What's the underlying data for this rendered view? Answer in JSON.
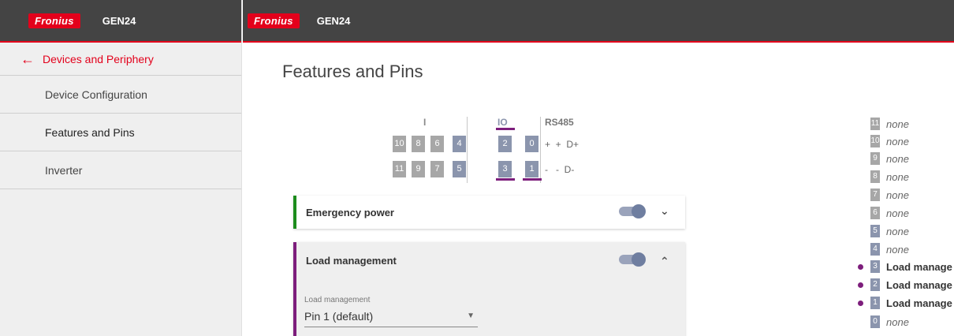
{
  "brand": {
    "logo_text": "Fronius",
    "product": "GEN24",
    "accent": "#e3001b"
  },
  "sidebar": {
    "back_label": "Devices and Periphery",
    "items": [
      {
        "label": "Device Configuration"
      },
      {
        "label": "Features and Pins",
        "active": true
      },
      {
        "label": "Inverter"
      }
    ]
  },
  "page": {
    "title": "Features and Pins"
  },
  "pins": {
    "groups": {
      "i": "I",
      "io": "IO",
      "rs485": "RS485"
    },
    "top_row": [
      "10",
      "8",
      "6",
      "4",
      "2",
      "0"
    ],
    "bottom_row": [
      "11",
      "9",
      "7",
      "5",
      "3",
      "1"
    ],
    "rs_top": "+  +  D+",
    "rs_bottom": "-   -  D-"
  },
  "cards": {
    "emergency": {
      "title": "Emergency power",
      "enabled": true
    },
    "load": {
      "title": "Load management",
      "enabled": true,
      "field_label": "Load management",
      "field_value": "Pin 1 (default)"
    }
  },
  "assignments": [
    {
      "pin": "11",
      "value": "none",
      "assigned": false
    },
    {
      "pin": "10",
      "value": "none",
      "assigned": false
    },
    {
      "pin": "9",
      "value": "none",
      "assigned": false
    },
    {
      "pin": "8",
      "value": "none",
      "assigned": false
    },
    {
      "pin": "7",
      "value": "none",
      "assigned": false
    },
    {
      "pin": "6",
      "value": "none",
      "assigned": false
    },
    {
      "pin": "5",
      "value": "none",
      "assigned": false
    },
    {
      "pin": "4",
      "value": "none",
      "assigned": false
    },
    {
      "pin": "3",
      "value": "Load manage",
      "assigned": true
    },
    {
      "pin": "2",
      "value": "Load manage",
      "assigned": true
    },
    {
      "pin": "1",
      "value": "Load manage",
      "assigned": true
    },
    {
      "pin": "0",
      "value": "none",
      "assigned": false
    }
  ]
}
